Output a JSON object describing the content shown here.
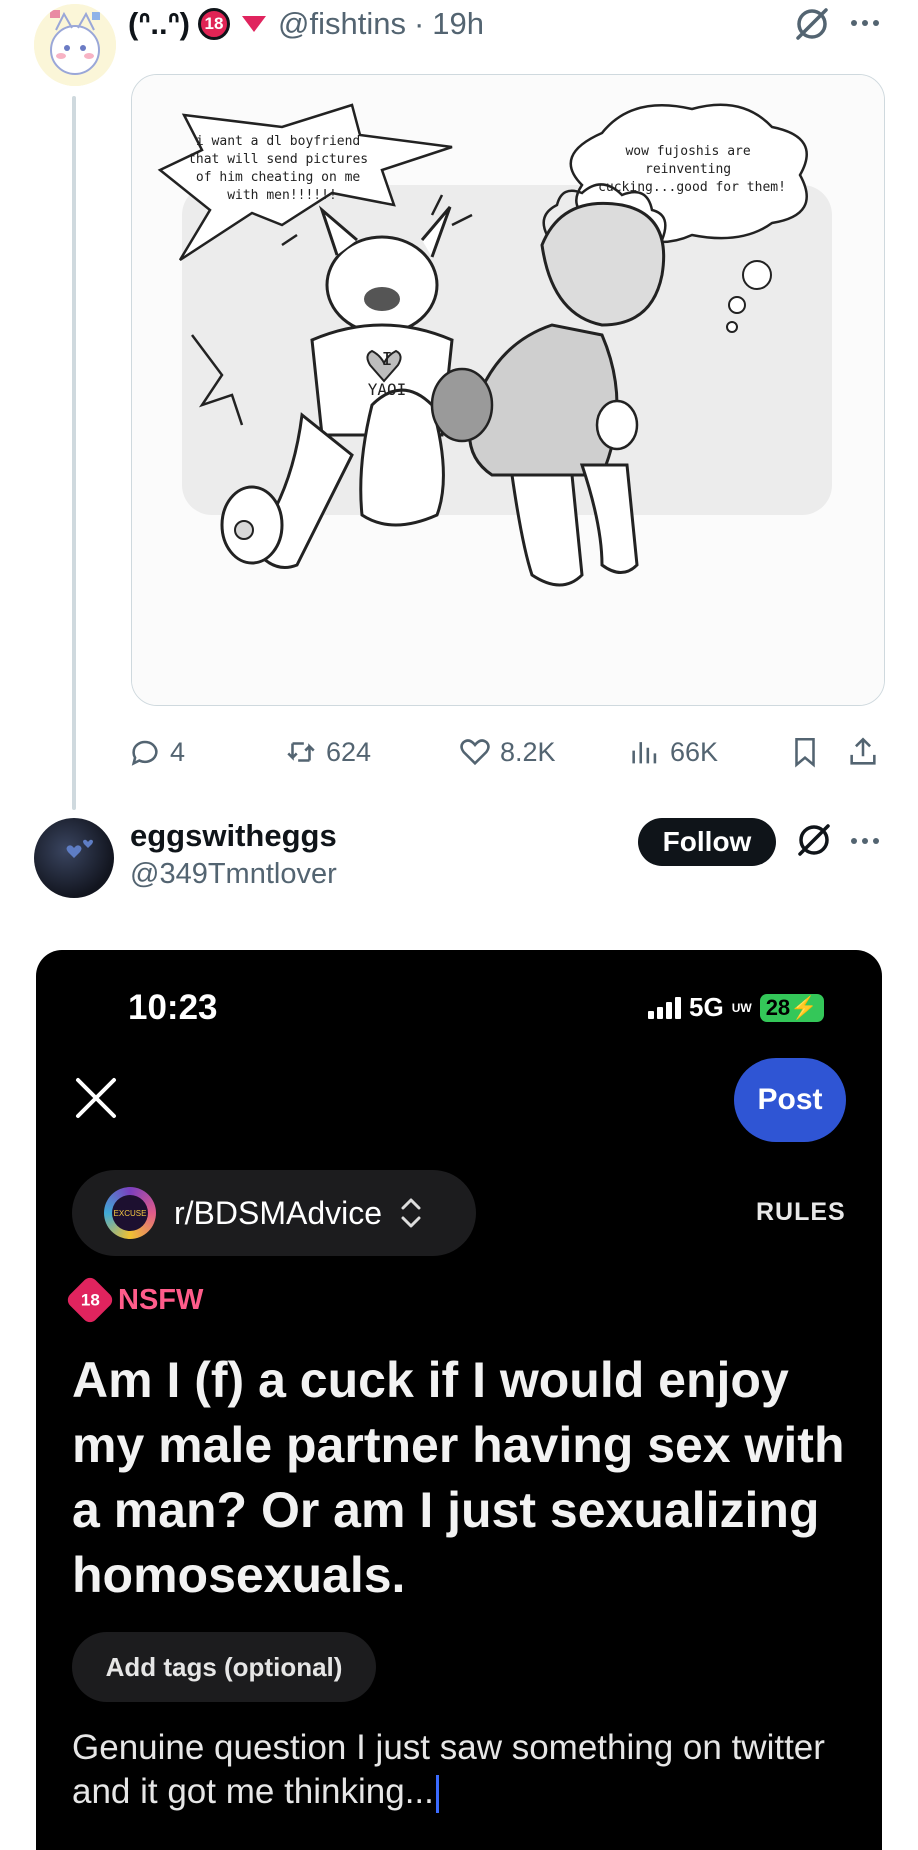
{
  "tweet1": {
    "display_name": "(ᐢ..ᐢ)",
    "age_badge": "18",
    "handle": "@fishtins",
    "separator": "·",
    "time": "19h",
    "image": {
      "speech_bubble_left": "i want a dl boyfriend that will send pictures of him cheating on me with men!!!!!!",
      "thought_bubble_right": "wow fujoshis are reinventing cucking...good for them!",
      "shirt_text_top": "I",
      "shirt_text_bottom": "YAOI"
    },
    "actions": {
      "replies": "4",
      "reposts": "624",
      "likes": "8.2K",
      "views": "66K"
    }
  },
  "tweet2": {
    "display_name": "eggswitheggs",
    "handle": "@349Tmntlover",
    "follow_label": "Follow",
    "screenshot": {
      "status_time": "10:23",
      "network": "5G",
      "network_sup": "UW",
      "battery": "28",
      "post_label": "Post",
      "subreddit": "r/BDSMAdvice",
      "subreddit_icon_text": "EXCUSE",
      "rules_label": "RULES",
      "nsfw_badge": "18",
      "nsfw_label": "NSFW",
      "title": "Am I (f) a cuck if I would enjoy my male partner having sex with a man? Or am I just sexualizing homosexuals.",
      "tags_label": "Add tags (optional)",
      "body": "Genuine question I just saw something on twitter and it got me thinking..."
    }
  },
  "colors": {
    "accent_pink": "#e0245e",
    "post_blue": "#2f55d4",
    "secondary_text": "#536471"
  }
}
